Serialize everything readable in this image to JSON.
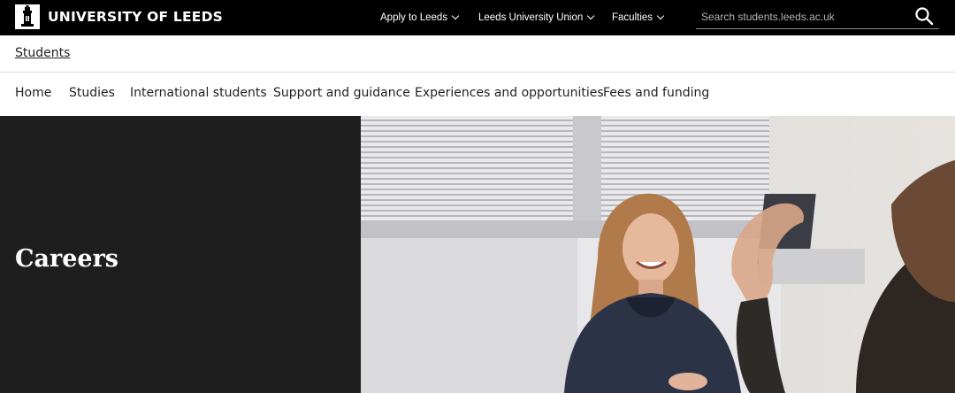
{
  "header": {
    "brand": "UNIVERSITY OF LEEDS",
    "nav": [
      {
        "label": "Apply to Leeds"
      },
      {
        "label": "Leeds University Union"
      },
      {
        "label": "Faculties"
      }
    ],
    "search_placeholder": "Search students.leeds.ac.uk"
  },
  "site": {
    "title": "Students"
  },
  "main_nav": [
    {
      "label": "Home"
    },
    {
      "label": "Studies"
    },
    {
      "label": "International students"
    },
    {
      "label": "Support and guidance"
    },
    {
      "label": "Experiences and opportunities"
    },
    {
      "label": "Fees and funding"
    }
  ],
  "hero": {
    "title": "Careers"
  },
  "icons": {
    "logo": "university-crest-icon",
    "search": "search-icon",
    "dropdown": "chevron-down-icon"
  }
}
